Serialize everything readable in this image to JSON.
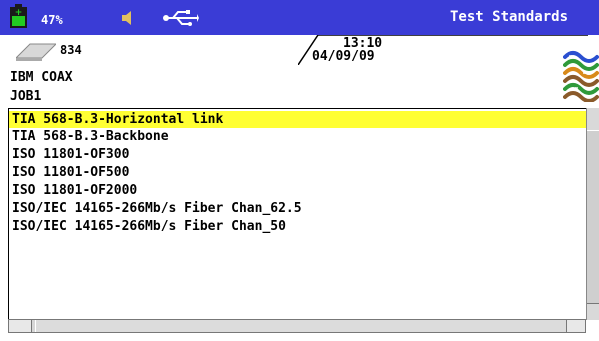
{
  "status_bar": {
    "battery_percent": "47%",
    "title": "Test Standards"
  },
  "header": {
    "memory_count": "834",
    "time": "13:10",
    "date": "04/09/09",
    "cable_type": "IBM COAX",
    "job": "JOB1"
  },
  "list": {
    "selected_index": 0,
    "items": [
      "TIA 568-B.3-Horizontal link",
      "TIA 568-B.3-Backbone",
      "ISO 11801-OF300",
      "ISO 11801-OF500",
      "ISO 11801-OF2000",
      "ISO/IEC 14165-266Mb/s Fiber Chan_62.5",
      "ISO/IEC 14165-266Mb/s Fiber Chan_50"
    ]
  },
  "colors": {
    "status_bar": "#3a3cd6",
    "selection": "#ffff33"
  },
  "icons": {
    "battery": "battery-icon",
    "speaker": "speaker-icon",
    "usb": "usb-icon",
    "memory": "memory-card-icon",
    "cable": "cable-bundle-icon"
  }
}
